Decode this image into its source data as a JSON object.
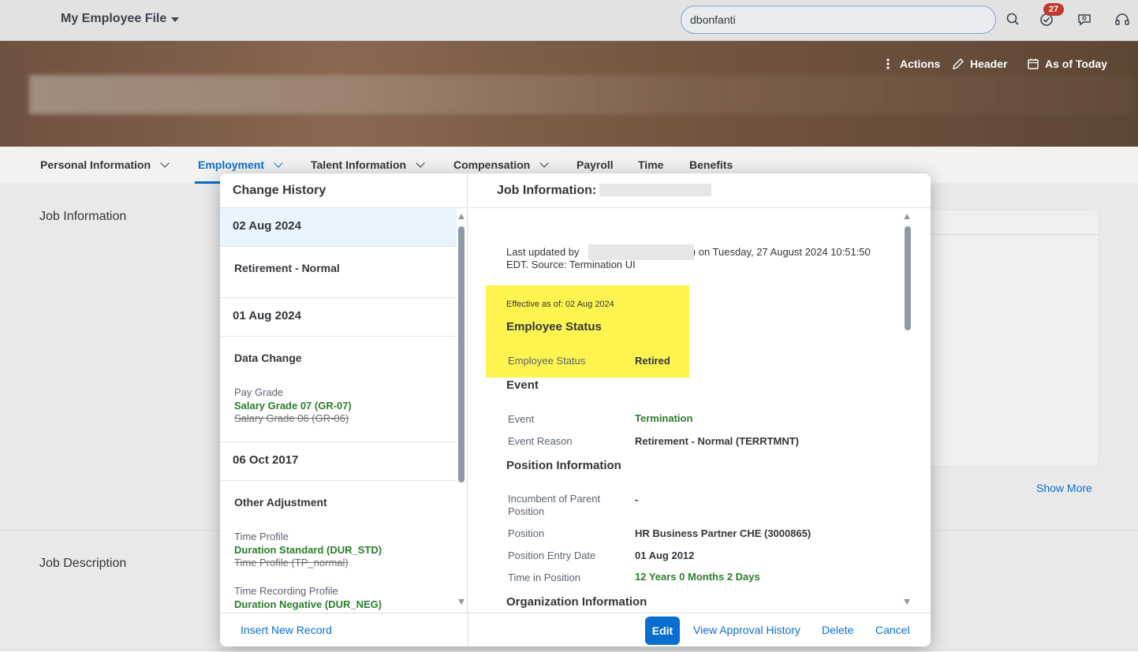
{
  "shell": {
    "app_title": "My Employee File",
    "search_value": "dbonfanti",
    "notification_count": "27"
  },
  "header": {
    "actions_label": "Actions",
    "header_label": "Header",
    "as_of_label": "As of Today"
  },
  "nav": {
    "tabs": [
      {
        "label": "Personal Information"
      },
      {
        "label": "Employment"
      },
      {
        "label": "Talent Information"
      },
      {
        "label": "Compensation"
      },
      {
        "label": "Payroll"
      },
      {
        "label": "Time"
      },
      {
        "label": "Benefits"
      }
    ]
  },
  "page": {
    "job_information_title": "Job Information",
    "job_description_title": "Job Description",
    "show_more": "Show More"
  },
  "dialog": {
    "left_title": "Change History",
    "history": [
      {
        "date": "02 Aug 2024",
        "type": "Retirement - Normal",
        "changes": []
      },
      {
        "date": "01 Aug 2024",
        "type": "Data Change",
        "changes": [
          {
            "label": "Pay Grade",
            "new": "Salary Grade 07 (GR-07)",
            "old": "Salary Grade 06 (GR-06)"
          }
        ]
      },
      {
        "date": "06 Oct 2017",
        "type": "Other Adjustment",
        "changes": [
          {
            "label": "Time Profile",
            "new": "Duration Standard (DUR_STD)",
            "old": "Time Profile (TP_normal)"
          },
          {
            "label": "Time Recording Profile",
            "new": "Duration Negative (DUR_NEG)"
          }
        ]
      }
    ],
    "right_title": "Job Information:",
    "meta_line1_prefix": "Last updated by",
    "meta_line1_suffix": ") on Tuesday, 27 August 2024 10:51:50",
    "meta_line2": "EDT. Source: Termination UI",
    "effective": "Effective as of: 02 Aug 2024",
    "groups": {
      "employee_status": {
        "title": "Employee Status",
        "fields": [
          {
            "label": "Employee Status",
            "value": "Retired"
          }
        ]
      },
      "event": {
        "title": "Event",
        "fields": [
          {
            "label": "Event",
            "value": "Termination"
          },
          {
            "label": "Event Reason",
            "value": "Retirement - Normal (TERRTMNT)"
          }
        ]
      },
      "position": {
        "title": "Position Information",
        "fields": [
          {
            "label": "Incumbent of Parent Position",
            "value": "-"
          },
          {
            "label": "Position",
            "value": "HR Business Partner CHE (3000865)"
          },
          {
            "label": "Position Entry Date",
            "value": "01 Aug 2012"
          },
          {
            "label": "Time in Position",
            "value": "12 Years 0 Months 2 Days"
          }
        ]
      },
      "organization": {
        "title": "Organization Information"
      }
    },
    "footer": {
      "insert": "Insert New Record",
      "edit": "Edit",
      "approval": "View Approval History",
      "delete": "Delete",
      "cancel": "Cancel"
    }
  },
  "colors": {
    "accent": "#0a6ed1",
    "changed_value": "#2b7d2b",
    "highlight": "#fff44f",
    "badge": "#c0392b"
  },
  "icons": [
    "dropdown-caret-icon",
    "search-icon",
    "task-check-icon",
    "notification-chat-icon",
    "headset-icon",
    "more-vertical-icon",
    "pencil-icon",
    "calendar-icon",
    "chevron-down-icon"
  ]
}
